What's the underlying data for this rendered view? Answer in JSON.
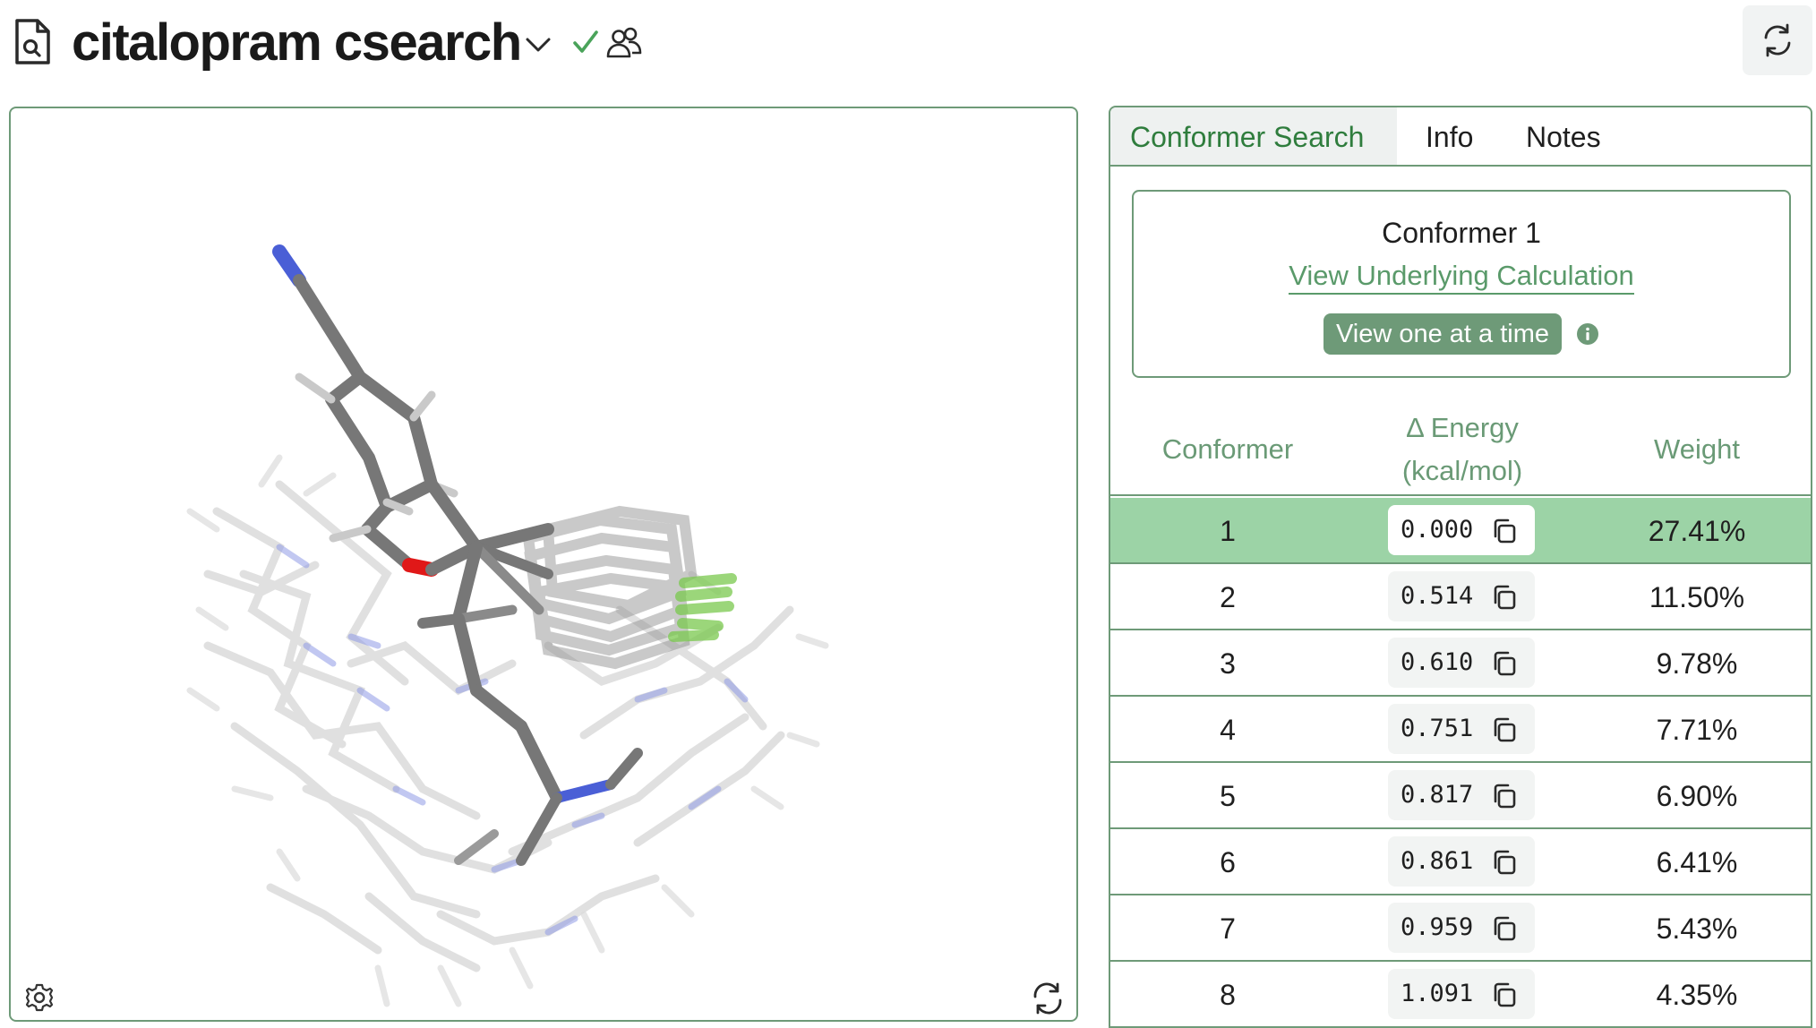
{
  "header": {
    "title": "citalopram csearch"
  },
  "tabs": [
    {
      "label": "Conformer Search",
      "active": true
    },
    {
      "label": "Info",
      "active": false
    },
    {
      "label": "Notes",
      "active": false
    }
  ],
  "card": {
    "title": "Conformer 1",
    "link": "View Underlying Calculation",
    "toggle": "View one at a time"
  },
  "table": {
    "headers": {
      "conformer": "Conformer",
      "energy_line1": "Δ Energy",
      "energy_line2": "(kcal/mol)",
      "weight": "Weight"
    },
    "rows": [
      {
        "n": "1",
        "energy": "0.000",
        "weight": "27.41%",
        "selected": true
      },
      {
        "n": "2",
        "energy": "0.514",
        "weight": "11.50%"
      },
      {
        "n": "3",
        "energy": "0.610",
        "weight": "9.78%"
      },
      {
        "n": "4",
        "energy": "0.751",
        "weight": "7.71%"
      },
      {
        "n": "5",
        "energy": "0.817",
        "weight": "6.90%"
      },
      {
        "n": "6",
        "energy": "0.861",
        "weight": "6.41%"
      },
      {
        "n": "7",
        "energy": "0.959",
        "weight": "5.43%"
      },
      {
        "n": "8",
        "energy": "1.091",
        "weight": "4.35%"
      }
    ]
  },
  "colors": {
    "accent_green": "#2f7d3d",
    "border_green": "#6e9a78",
    "selected_row": "#9cd3a6",
    "carbon": "#777777",
    "nitrogen": "#4a5fd6",
    "oxygen": "#e01818",
    "fluorine": "#7ac94e"
  },
  "icons": {
    "doc": "document-search-icon",
    "chevron": "chevron-down-icon",
    "check": "check-icon",
    "people": "users-icon",
    "refresh": "refresh-icon",
    "gear": "gear-icon",
    "info": "info-icon",
    "copy": "copy-icon"
  }
}
